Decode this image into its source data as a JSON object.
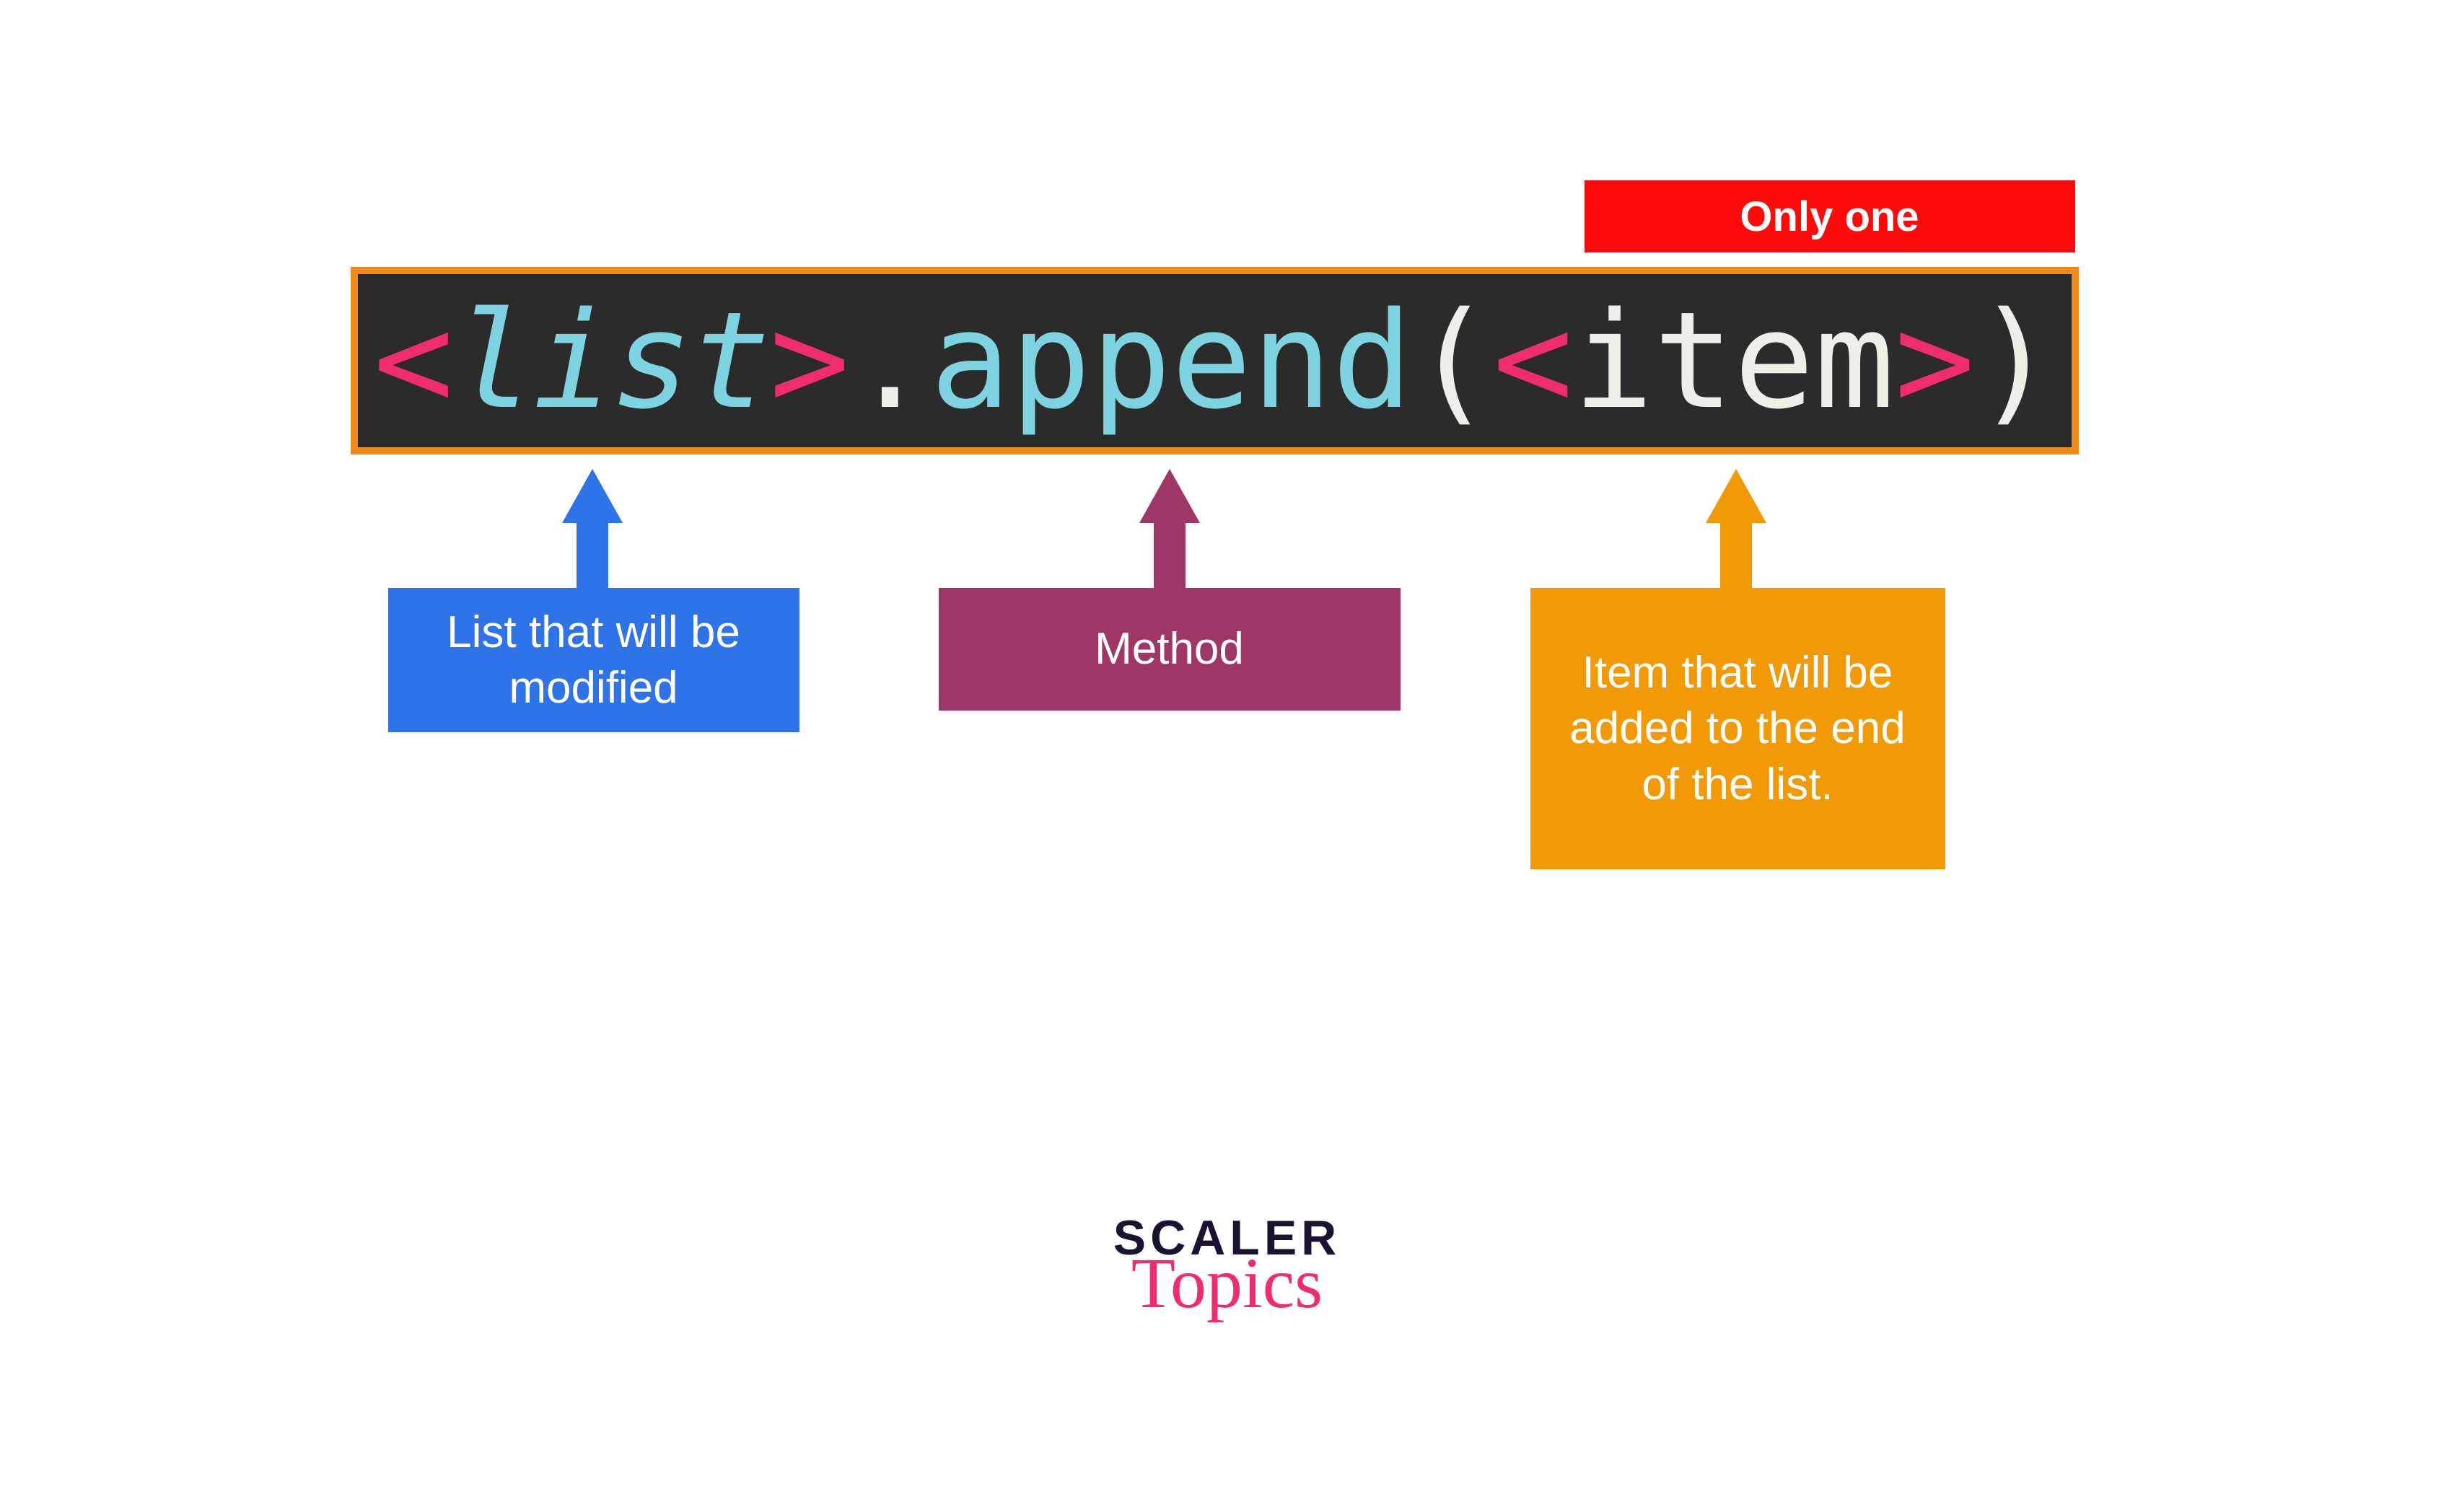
{
  "badge": {
    "only_one": "Only one"
  },
  "code": {
    "angle_open": "<",
    "angle_close": ">",
    "list_ident": "list",
    "dot": ".",
    "method": "append",
    "paren_open": "(",
    "item_ident": "item",
    "paren_close": ")"
  },
  "labels": {
    "list": "List that will be modified",
    "method": "Method",
    "item": "Item that will be added to the end of the list."
  },
  "logo": {
    "line1": "SCALER",
    "line2": "Topics"
  },
  "colors": {
    "badge_red": "#ff0a0a",
    "code_bg": "#2b2b2b",
    "code_border": "#f08a1a",
    "angle_pink": "#ef2d6d",
    "cyan": "#7dd3e0",
    "offwhite": "#f0eee9",
    "blue": "#2e73e8",
    "purple": "#9e3765",
    "orange": "#f29a05",
    "logo_dark": "#1a1230"
  }
}
